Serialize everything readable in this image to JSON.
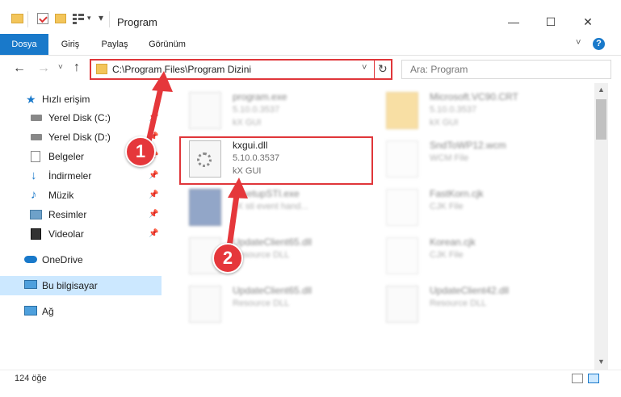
{
  "window": {
    "title": "Program",
    "tabs": [
      {
        "label": "Dosya",
        "active": true
      },
      {
        "label": "Giriş",
        "active": false
      },
      {
        "label": "Paylaş",
        "active": false
      },
      {
        "label": "Görünüm",
        "active": false
      }
    ],
    "minimize": "—",
    "maximize": "☐",
    "close": "✕",
    "help": "?"
  },
  "nav": {
    "address": "C:\\Program Files\\Program Dizini",
    "search_placeholder": "Ara: Program"
  },
  "sidebar": {
    "items": [
      {
        "label": "Hızlı erişim",
        "icon": "star-icon"
      },
      {
        "label": "Yerel Disk (C:)",
        "icon": "drive-icon",
        "pinned": true
      },
      {
        "label": "Yerel Disk (D:)",
        "icon": "drive-icon",
        "pinned": true
      },
      {
        "label": "Belgeler",
        "icon": "documents-icon",
        "pinned": true
      },
      {
        "label": "İndirmeler",
        "icon": "download-icon",
        "pinned": true
      },
      {
        "label": "Müzik",
        "icon": "music-icon",
        "pinned": true
      },
      {
        "label": "Resimler",
        "icon": "pictures-icon",
        "pinned": true
      },
      {
        "label": "Videolar",
        "icon": "videos-icon",
        "pinned": true
      },
      {
        "label": "OneDrive",
        "icon": "onedrive-icon"
      },
      {
        "label": "Bu bilgisayar",
        "icon": "computer-icon",
        "selected": true
      },
      {
        "label": "Ağ",
        "icon": "network-icon"
      }
    ]
  },
  "files": [
    {
      "name": "program.exe",
      "line2": "5.10.0.3537",
      "line3": "kX GUI"
    },
    {
      "name": "Microsoft.VC90.CRT",
      "line2": "5.10.0.3537",
      "line3": "kX GUI"
    },
    {
      "name": "kxgui.dll",
      "line2": "5.10.0.3537",
      "line3": "kX GUI"
    },
    {
      "name": "SndToWP12.wcm",
      "line2": "WCM File",
      "line3": ""
    },
    {
      "name": "kxsetupSTI.exe",
      "line2": "kX sti event hand...",
      "line3": ""
    },
    {
      "name": "FastKorn.cjk",
      "line2": "CJK File",
      "line3": ""
    },
    {
      "name": "UpdateClient65.dll",
      "line2": "Resource DLL",
      "line3": ""
    },
    {
      "name": "Korean.cjk",
      "line2": "CJK File",
      "line3": ""
    },
    {
      "name": "UpdateClient65.dll",
      "line2": "Resource DLL",
      "line3": ""
    },
    {
      "name": "UpdateClient42.dll",
      "line2": "Resource DLL",
      "line3": ""
    }
  ],
  "status": {
    "count": "124 öğe"
  },
  "annotations": {
    "badge1": "1",
    "badge2": "2"
  },
  "colors": {
    "accent": "#1979ca",
    "highlight": "#e0363a",
    "selected_bg": "#cce8ff"
  }
}
